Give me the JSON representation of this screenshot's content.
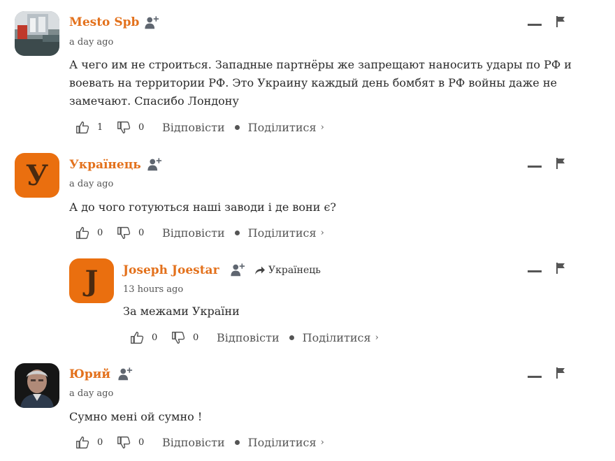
{
  "comments": [
    {
      "author": "Mesto Spb",
      "time": "a day ago",
      "text": "А чего им не строиться. Западные партнёры же запрещают наносить удары по РФ и воевать на территории РФ. Это Украину каждый день бомбят в РФ войны даже не замечают. Спасибо Лондону",
      "likes": "1",
      "dislikes": "0",
      "reply_label": "Відповісти",
      "share_label": "Поділитися"
    },
    {
      "author": "Українець",
      "avatar_letter": "У",
      "time": "a day ago",
      "text": "А до чого готуються наші заводи і де вони є?",
      "likes": "0",
      "dislikes": "0",
      "reply_label": "Відповісти",
      "share_label": "Поділитися"
    },
    {
      "author": "Joseph Joestar",
      "avatar_letter": "J",
      "reply_to": "Українець",
      "time": "13 hours ago",
      "text": "За межами України",
      "likes": "0",
      "dislikes": "0",
      "reply_label": "Відповісти",
      "share_label": "Поділитися"
    },
    {
      "author": "Юрий",
      "time": "a day ago",
      "text": "Сумно мені ой сумно !",
      "likes": "0",
      "dislikes": "0",
      "reply_label": "Відповісти",
      "share_label": "Поділитися"
    }
  ],
  "colors": {
    "author": "#e3711c",
    "avatar_bg": "#ea6f0f",
    "icon_gray": "#555555"
  },
  "icons": [
    "follow-icon",
    "thumbs-up-icon",
    "thumbs-down-icon",
    "collapse-icon",
    "flag-icon",
    "reply-arrow-icon",
    "chevron-right-icon"
  ]
}
